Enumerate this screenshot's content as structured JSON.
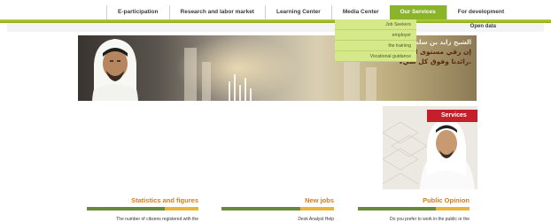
{
  "nav": {
    "items": [
      {
        "label": "E-participation"
      },
      {
        "label": "Research and labor market"
      },
      {
        "label": "Learning Center"
      },
      {
        "label": "Media Center"
      },
      {
        "label": "Our Services"
      },
      {
        "label": "For development"
      }
    ],
    "active_index": 4,
    "open_data_label": "Open data"
  },
  "dropdown": {
    "items": [
      {
        "label": "Job Seekers"
      },
      {
        "label": "employer"
      },
      {
        "label": "the training"
      },
      {
        "label": "Vocational guidance"
      }
    ]
  },
  "banner": {
    "name_line": "الشيخ زايد بن سلطان",
    "quote_line_1": "إن رقي مستوى الإنسان",
    "quote_line_2": "رائدنا وفوق كل شيء."
  },
  "services": {
    "tab_label": "Services"
  },
  "columns": [
    {
      "title": "Statistics and figures",
      "text": "The number of citizens registered with the"
    },
    {
      "title": "New jobs",
      "text": "Desk Analyst Help"
    },
    {
      "title": "Public Opinion",
      "text": "Do you prefer to work in the public or the"
    }
  ],
  "colors": {
    "accent": "#8ab42a",
    "dropdown_bg": "#d6e98a",
    "section_title": "#d97a1a",
    "services_tab": "#c3202b"
  }
}
